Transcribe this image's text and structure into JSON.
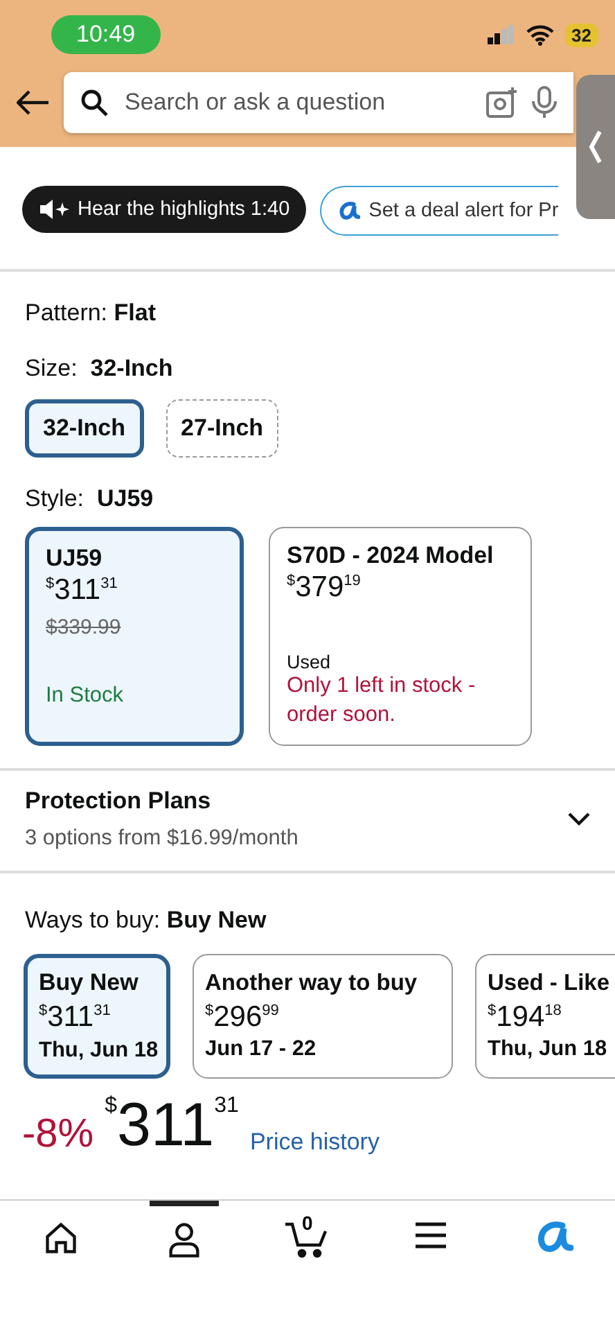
{
  "status_bar": {
    "time": "10:49",
    "battery": "32"
  },
  "header": {
    "search": {
      "placeholder": "Search or ask a question"
    }
  },
  "chips": [
    {
      "kind": "audio",
      "label": "Hear the highlights 1:40"
    },
    {
      "kind": "alert",
      "label": "Set a deal alert for Pr"
    }
  ],
  "pattern": {
    "label": "Pattern:",
    "value": "Flat"
  },
  "size": {
    "label": "Size:",
    "value": "32-Inch",
    "options": [
      {
        "label": "32-Inch",
        "selected": true
      },
      {
        "label": "27-Inch",
        "selected": false
      }
    ]
  },
  "style": {
    "label": "Style:",
    "value": "UJ59",
    "options": [
      {
        "title": "UJ59",
        "price": {
          "symbol": "$",
          "whole": "311",
          "fraction": "31"
        },
        "list_price": "$339.99",
        "availability": "In Stock",
        "in_stock": true,
        "selected": true
      },
      {
        "title": "S70D - 2024 Model",
        "price": {
          "symbol": "$",
          "whole": "379",
          "fraction": "19"
        },
        "condition": "Used",
        "availability": "Only 1 left in stock - order soon.",
        "in_stock": false,
        "selected": false
      }
    ]
  },
  "protection_plans": {
    "title": "Protection Plans",
    "subtitle": "3 options from $16.99/month",
    "expanded": false
  },
  "ways_to_buy": {
    "label": "Ways to buy:",
    "value": "Buy New",
    "options": [
      {
        "title": "Buy New",
        "price": {
          "symbol": "$",
          "whole": "311",
          "fraction": "31"
        },
        "delivery": "Thu, Jun 18",
        "selected": true
      },
      {
        "title": "Another way to buy",
        "price": {
          "symbol": "$",
          "whole": "296",
          "fraction": "99"
        },
        "delivery": "Jun 17 - 22",
        "selected": false
      },
      {
        "title": "Used - Like",
        "price": {
          "symbol": "$",
          "whole": "194",
          "fraction": "18"
        },
        "delivery": "Thu, Jun 18",
        "selected": false
      }
    ]
  },
  "price": {
    "discount": "-8%",
    "symbol": "$",
    "whole": "311",
    "fraction": "31",
    "link": "Price history"
  },
  "nav": [
    {
      "kind": "home",
      "selected": false
    },
    {
      "kind": "account",
      "selected": true
    },
    {
      "kind": "cart",
      "count": "0",
      "selected": false
    },
    {
      "kind": "menu",
      "selected": false
    },
    {
      "kind": "assistant",
      "selected": false
    }
  ]
}
